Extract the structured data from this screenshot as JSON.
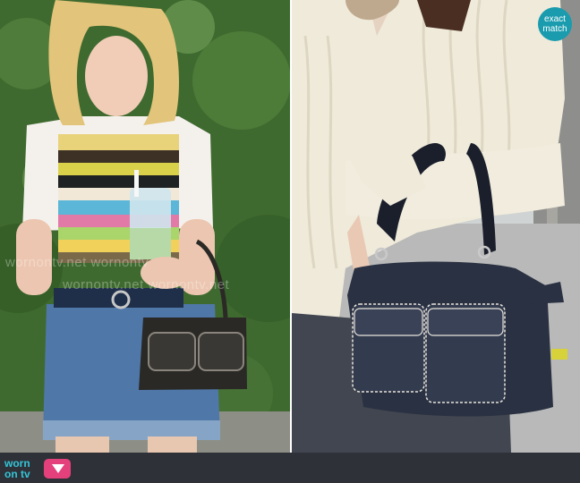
{
  "left_photo": {
    "description_icon": "photo",
    "watermark_line1": "wornontv.net  wornontv",
    "watermark_line2": "wornontv.net  wornontv.net"
  },
  "right_photo": {
    "badge": {
      "line1": "exact",
      "line2": "match"
    }
  },
  "footer": {
    "logo": {
      "text_top": "worn",
      "text_bottom": "on tv"
    }
  },
  "colors": {
    "badge": "#1a9cae",
    "footer": "#2e3138",
    "logo_text": "#35c4d8",
    "logo_tv": "#e4407b"
  }
}
